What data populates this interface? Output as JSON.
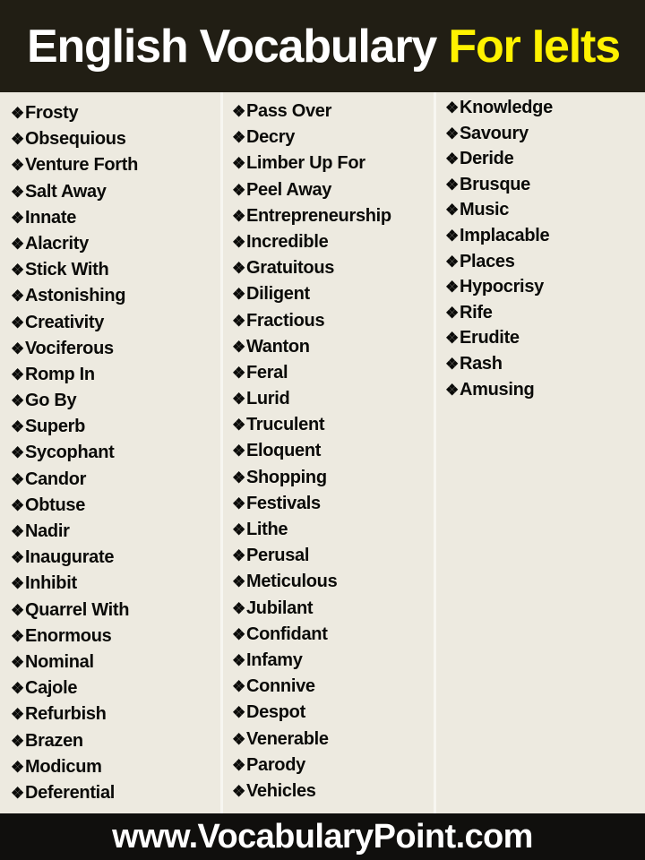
{
  "header": {
    "title_main": "English Vocabulary",
    "title_accent": "For Ielts",
    "background_color": "#211E14",
    "main_color": "#FFFFFF",
    "accent_color": "#FFF200"
  },
  "bullet_glyph": "❖",
  "bullet_icon_name": "diamond-bullet-icon",
  "columns": [
    {
      "id": "column-1",
      "items": [
        "Frosty",
        "Obsequious",
        "Venture Forth",
        "Salt Away",
        "Innate",
        "Alacrity",
        "Stick With",
        "Astonishing",
        "Creativity",
        "Vociferous",
        "Romp In",
        "Go By",
        "Superb",
        "Sycophant",
        "Candor",
        "Obtuse",
        "Nadir",
        "Inaugurate",
        "Inhibit",
        "Quarrel With",
        "Enormous",
        "Nominal",
        "Cajole",
        "Refurbish",
        "Brazen",
        "Modicum",
        "Deferential"
      ]
    },
    {
      "id": "column-2",
      "items": [
        "Pass Over",
        "Decry",
        "Limber Up For",
        "Peel Away",
        "Entrepreneurship",
        "Incredible",
        "Gratuitous",
        "Diligent",
        "Fractious",
        "Wanton",
        "Feral",
        "Lurid",
        "Truculent",
        "Eloquent",
        "Shopping",
        "Festivals",
        "Lithe",
        "Perusal",
        "Meticulous",
        "Jubilant",
        "Confidant",
        "Infamy",
        "Connive",
        "Despot",
        "Venerable",
        "Parody",
        "Vehicles"
      ]
    },
    {
      "id": "column-3",
      "items": [
        "Knowledge",
        "Savoury",
        "Deride",
        "Brusque",
        "Music",
        "Implacable",
        "Places",
        "Hypocrisy",
        "Rife",
        "Erudite",
        "Rash",
        "Amusing"
      ]
    }
  ],
  "footer": {
    "website": "www.VocabularyPoint.com",
    "background_color": "#100F0D",
    "text_color": "#FFFFFF"
  },
  "page": {
    "background_color": "#EDEAE0",
    "divider_color": "#F7F6F1"
  }
}
